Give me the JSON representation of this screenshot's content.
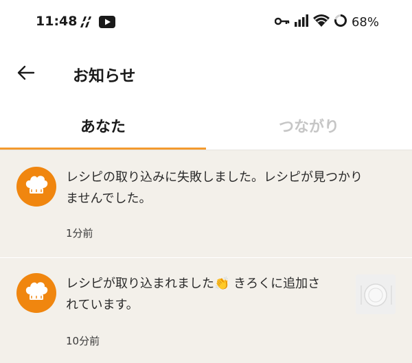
{
  "status_bar": {
    "time": "11:48",
    "battery": "68%",
    "icons": [
      "pen-slash-icon",
      "youtube-icon",
      "vpn-key-icon",
      "signal-icon",
      "wifi-icon",
      "battery-ring-icon"
    ]
  },
  "header": {
    "title": "お知らせ",
    "back_icon": "arrow-left-icon"
  },
  "tabs": [
    {
      "label": "あなた",
      "active": true
    },
    {
      "label": "つながり",
      "active": false
    }
  ],
  "notifications": [
    {
      "line1": "レシピの取り込みに失敗しました。レシピが見つかり",
      "line2": "ませんでした。",
      "time": "1分前",
      "avatar_icon": "chef-hat-icon"
    },
    {
      "line1": "レシピが取り込まれました👏 きろくに追加さ",
      "line2": "れています。",
      "time": "10分前",
      "avatar_icon": "chef-hat-icon",
      "thumbnail_icon": "plate-icon"
    }
  ],
  "colors": {
    "accent": "#f39a2e",
    "avatar": "#f0860f",
    "list_background": "#f3f0ea",
    "inactive_tab": "#c6c6c6"
  }
}
